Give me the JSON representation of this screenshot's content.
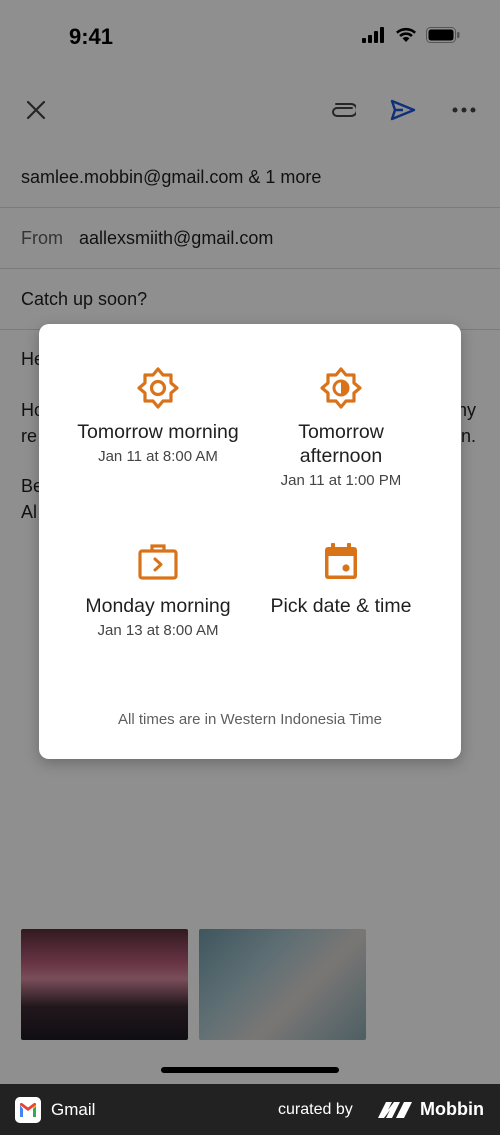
{
  "status_bar": {
    "time": "9:41"
  },
  "compose": {
    "to": "samlee.mobbin@gmail.com & 1 more",
    "from_label": "From",
    "from_value": "aallexsmiith@gmail.com",
    "subject": "Catch up soon?",
    "body_fragments": {
      "line1_left": "He",
      "line2_left": "Ho",
      "line2_right": "ny",
      "line3_left": "re",
      "line3_right": "n.",
      "line4_left": "Be",
      "line5_left": "Al"
    }
  },
  "schedule_dialog": {
    "options": [
      {
        "label": "Tomorrow morning",
        "sub": "Jan 11 at 8:00 AM",
        "icon": "sun-icon"
      },
      {
        "label_line1": "Tomorrow",
        "label_line2": "afternoon",
        "sub": "Jan 11 at 1:00 PM",
        "icon": "half-sun-icon"
      },
      {
        "label": "Monday morning",
        "sub": "Jan 13 at 8:00 AM",
        "icon": "briefcase-icon"
      },
      {
        "label": "Pick date & time",
        "icon": "calendar-icon"
      }
    ],
    "timezone_note": "All times are in Western Indonesia Time"
  },
  "accent_color": "#d9731a",
  "footer": {
    "app_name": "Gmail",
    "curated_by": "curated by",
    "brand": "Mobbin"
  }
}
